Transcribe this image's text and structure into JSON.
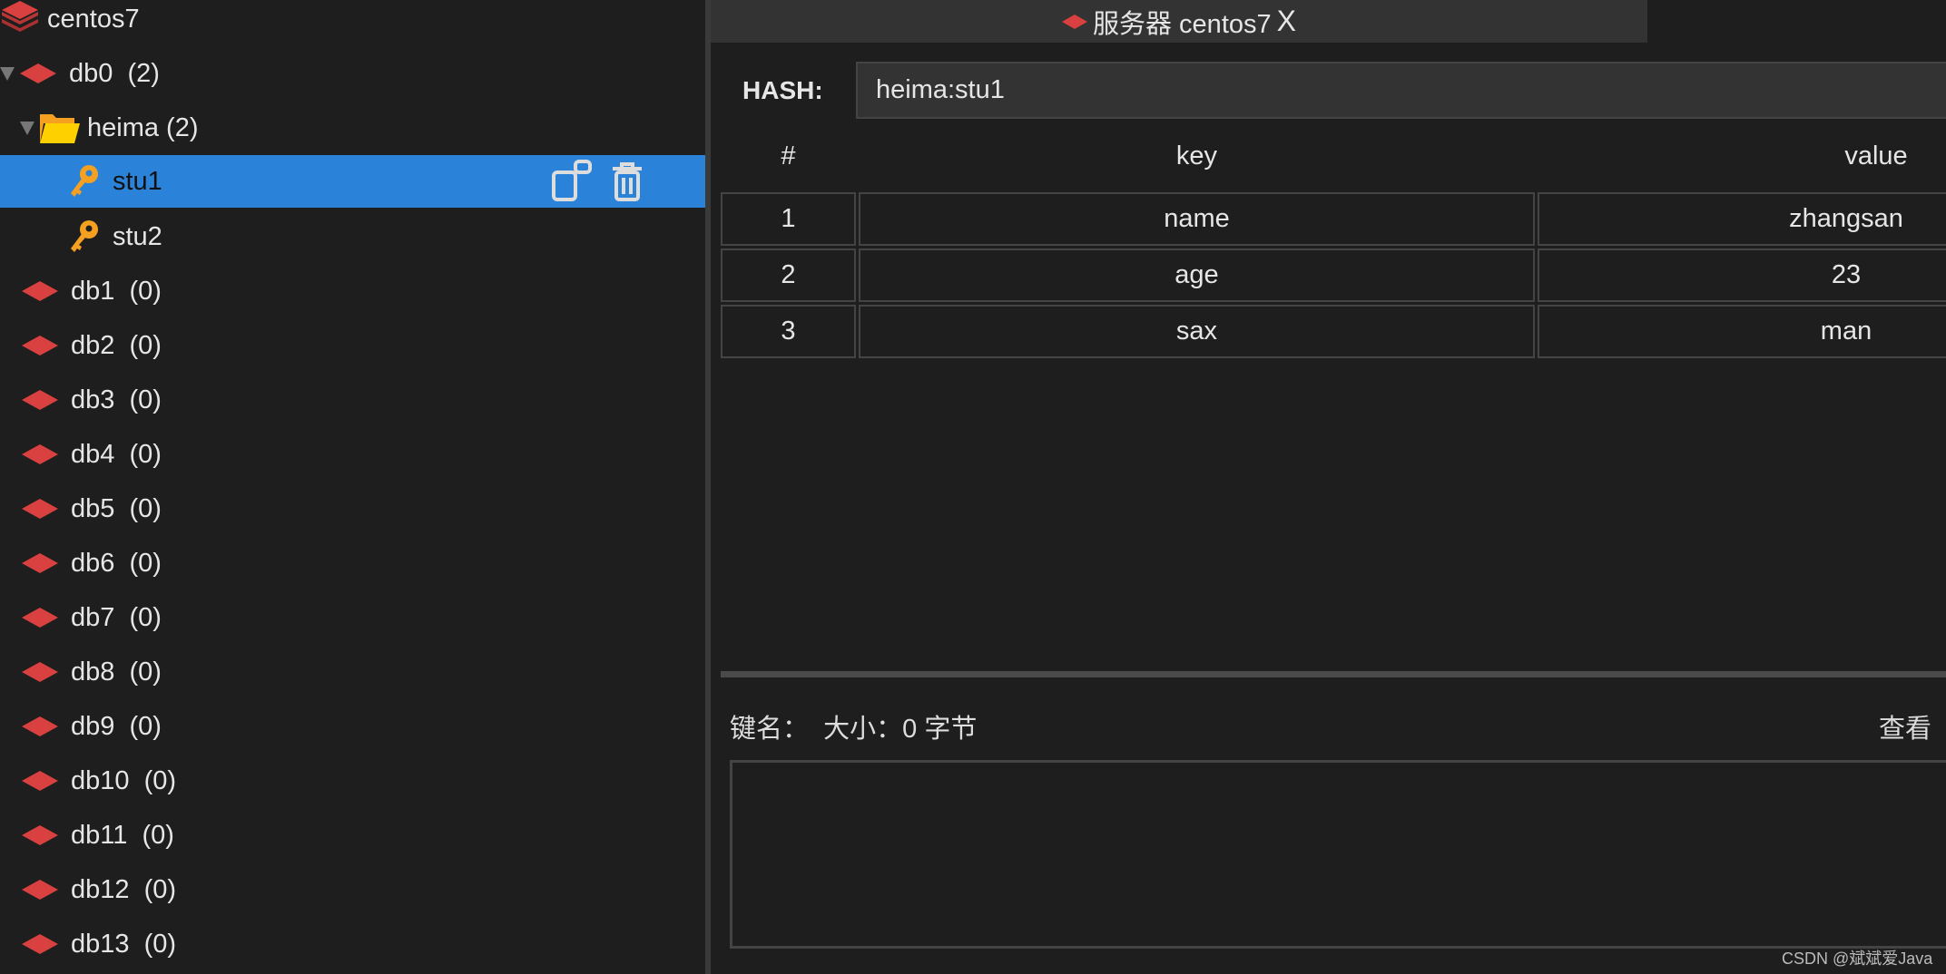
{
  "tree": {
    "server": "centos7",
    "db0": {
      "label": "db0",
      "count": "(2)"
    },
    "folder": {
      "label": "heima (2)"
    },
    "keys": [
      "stu1",
      "stu2"
    ],
    "dbs": [
      {
        "label": "db1",
        "count": "(0)"
      },
      {
        "label": "db2",
        "count": "(0)"
      },
      {
        "label": "db3",
        "count": "(0)"
      },
      {
        "label": "db4",
        "count": "(0)"
      },
      {
        "label": "db5",
        "count": "(0)"
      },
      {
        "label": "db6",
        "count": "(0)"
      },
      {
        "label": "db7",
        "count": "(0)"
      },
      {
        "label": "db8",
        "count": "(0)"
      },
      {
        "label": "db9",
        "count": "(0)"
      },
      {
        "label": "db10",
        "count": "(0)"
      },
      {
        "label": "db11",
        "count": "(0)"
      },
      {
        "label": "db12",
        "count": "(0)"
      },
      {
        "label": "db13",
        "count": "(0)"
      }
    ]
  },
  "tab": {
    "label": "服务器 centos7",
    "close": "X"
  },
  "hash": {
    "label": "HASH:",
    "value": "heima:stu1"
  },
  "table": {
    "headers": [
      "#",
      "key",
      "value"
    ],
    "rows": [
      [
        "1",
        "name",
        "zhangsan"
      ],
      [
        "2",
        "age",
        "23"
      ],
      [
        "3",
        "sax",
        "man"
      ]
    ]
  },
  "detail": {
    "key_label": "键名：",
    "size_label": "大小：0 字节",
    "view": "查看"
  },
  "watermark": "CSDN @斌斌爱Java",
  "colors": {
    "accent": "#2b83d9",
    "redis": "#d94040",
    "key": "#f5a020"
  }
}
